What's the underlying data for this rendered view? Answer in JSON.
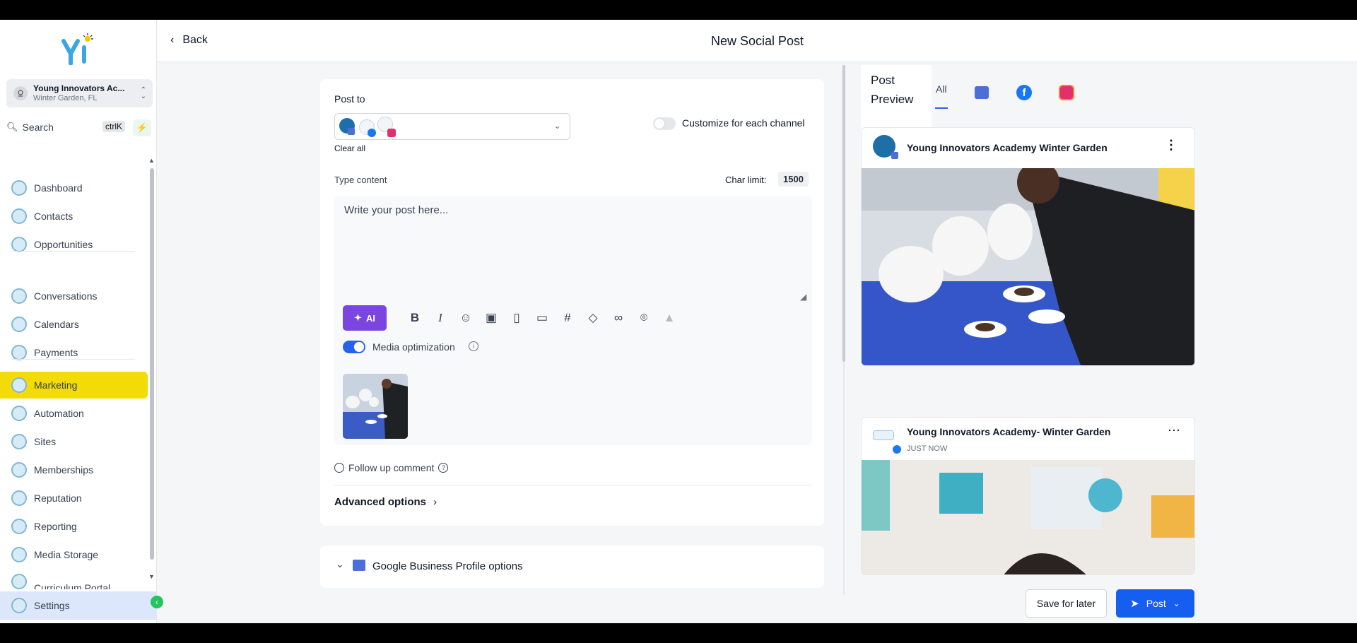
{
  "sidebar": {
    "location": {
      "name": "Young Innovators Ac...",
      "address": "Winter Garden, FL"
    },
    "search": {
      "label": "Search",
      "shortcut": "ctrlK"
    },
    "items": [
      {
        "label": "Dashboard"
      },
      {
        "label": "Contacts"
      },
      {
        "label": "Opportunities"
      },
      {
        "label": "Conversations"
      },
      {
        "label": "Calendars"
      },
      {
        "label": "Payments"
      },
      {
        "label": "Marketing"
      },
      {
        "label": "Automation"
      },
      {
        "label": "Sites"
      },
      {
        "label": "Memberships"
      },
      {
        "label": "Reputation"
      },
      {
        "label": "Reporting"
      },
      {
        "label": "Media Storage"
      },
      {
        "label": "Curriculum Portal"
      }
    ],
    "settings": "Settings",
    "accent": "#f3db08"
  },
  "header": {
    "back": "Back",
    "title": "New Social Post"
  },
  "editor": {
    "post_to": "Post to",
    "clear_all": "Clear all",
    "customize": "Customize for each channel",
    "type_content": "Type content",
    "char_limit_label": "Char limit:",
    "char_limit": "1500",
    "placeholder": "Write your post here...",
    "ai": "AI",
    "media_opt": "Media optimization",
    "follow_up": "Follow up comment",
    "advanced": "Advanced options",
    "gbp": "Google Business Profile options"
  },
  "preview": {
    "title_line1": "Post",
    "title_line2": "Preview",
    "tab_all": "All",
    "card1_name": "Young Innovators Academy Winter Garden",
    "card2_name": "Young Innovators Academy- Winter Garden",
    "card2_time": "JUST NOW"
  },
  "footer": {
    "save": "Save for later",
    "post": "Post"
  }
}
